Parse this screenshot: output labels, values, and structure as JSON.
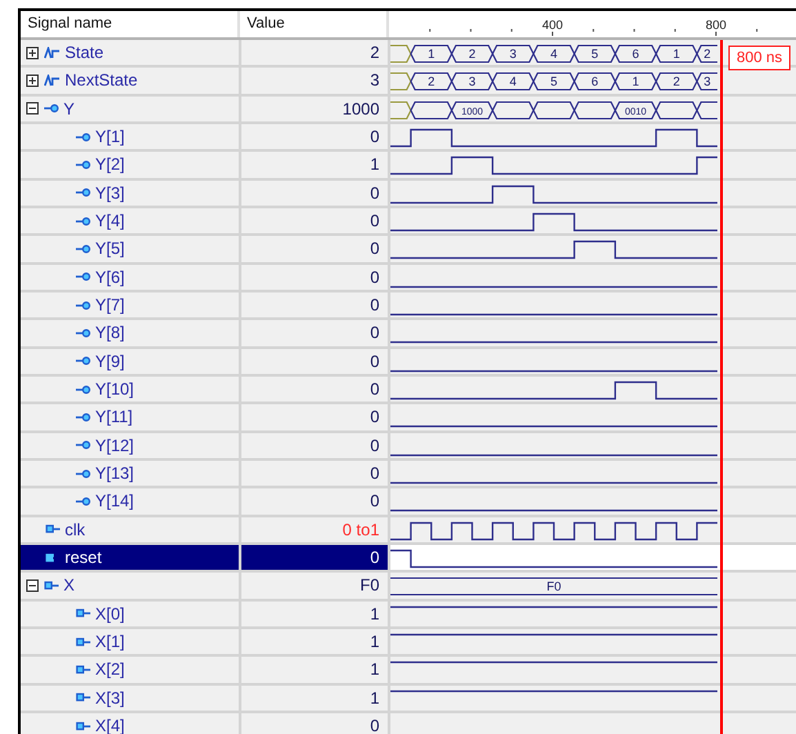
{
  "header": {
    "name": "Signal name",
    "value": "Value"
  },
  "ruler": {
    "ticks": [
      {
        "kind": "dot"
      },
      {
        "kind": "dot"
      },
      {
        "kind": "dot"
      },
      {
        "kind": "label",
        "label": "400"
      },
      {
        "kind": "dot"
      },
      {
        "kind": "dot"
      },
      {
        "kind": "dot"
      },
      {
        "kind": "label",
        "label": "800"
      },
      {
        "kind": "dot"
      }
    ]
  },
  "cursor": {
    "label": "800 ns"
  },
  "signals": [
    {
      "name": "State",
      "kind": "bus",
      "expanded": false,
      "selected": false,
      "changing": false,
      "value": "2",
      "wave": {
        "kind": "bus",
        "segments": [
          {
            "kind": "start"
          },
          {
            "kind": "full",
            "label": "1"
          },
          {
            "kind": "full",
            "label": "2"
          },
          {
            "kind": "full",
            "label": "3"
          },
          {
            "kind": "full",
            "label": "4"
          },
          {
            "kind": "full",
            "label": "5"
          },
          {
            "kind": "full",
            "label": "6"
          },
          {
            "kind": "full",
            "label": "1"
          },
          {
            "kind": "end",
            "label": "2"
          }
        ]
      }
    },
    {
      "name": "NextState",
      "kind": "bus",
      "expanded": false,
      "selected": false,
      "changing": false,
      "value": "3",
      "wave": {
        "kind": "bus",
        "segments": [
          {
            "kind": "start"
          },
          {
            "kind": "full",
            "label": "2"
          },
          {
            "kind": "full",
            "label": "3"
          },
          {
            "kind": "full",
            "label": "4"
          },
          {
            "kind": "full",
            "label": "5"
          },
          {
            "kind": "full",
            "label": "6"
          },
          {
            "kind": "full",
            "label": "1"
          },
          {
            "kind": "full",
            "label": "2"
          },
          {
            "kind": "end",
            "label": "3"
          }
        ]
      }
    },
    {
      "name": "Y",
      "kind": "out",
      "expanded": true,
      "selected": false,
      "changing": false,
      "value": "1000",
      "wave": {
        "kind": "bus",
        "segments": [
          {
            "kind": "start"
          },
          {
            "kind": "full"
          },
          {
            "kind": "full",
            "label": "1000"
          },
          {
            "kind": "full"
          },
          {
            "kind": "full"
          },
          {
            "kind": "full"
          },
          {
            "kind": "full",
            "label": "0010"
          },
          {
            "kind": "full"
          },
          {
            "kind": "end"
          }
        ]
      },
      "children": [
        {
          "name": "Y[1]",
          "kind": "out",
          "selected": false,
          "changing": false,
          "value": "0"
        },
        {
          "name": "Y[2]",
          "kind": "out",
          "selected": false,
          "changing": false,
          "value": "1"
        },
        {
          "name": "Y[3]",
          "kind": "out",
          "selected": false,
          "changing": false,
          "value": "0"
        },
        {
          "name": "Y[4]",
          "kind": "out",
          "selected": false,
          "changing": false,
          "value": "0"
        },
        {
          "name": "Y[5]",
          "kind": "out",
          "selected": false,
          "changing": false,
          "value": "0"
        },
        {
          "name": "Y[6]",
          "kind": "out",
          "selected": false,
          "changing": false,
          "value": "0"
        },
        {
          "name": "Y[7]",
          "kind": "out",
          "selected": false,
          "changing": false,
          "value": "0"
        },
        {
          "name": "Y[8]",
          "kind": "out",
          "selected": false,
          "changing": false,
          "value": "0"
        },
        {
          "name": "Y[9]",
          "kind": "out",
          "selected": false,
          "changing": false,
          "value": "0"
        },
        {
          "name": "Y[10]",
          "kind": "out",
          "selected": false,
          "changing": false,
          "value": "0"
        },
        {
          "name": "Y[11]",
          "kind": "out",
          "selected": false,
          "changing": false,
          "value": "0"
        },
        {
          "name": "Y[12]",
          "kind": "out",
          "selected": false,
          "changing": false,
          "value": "0"
        },
        {
          "name": "Y[13]",
          "kind": "out",
          "selected": false,
          "changing": false,
          "value": "0"
        },
        {
          "name": "Y[14]",
          "kind": "out",
          "selected": false,
          "changing": false,
          "value": "0"
        }
      ]
    },
    {
      "name": "clk",
      "kind": "in",
      "selected": false,
      "changing": true,
      "value": "0 to1"
    },
    {
      "name": "reset",
      "kind": "in",
      "selected": true,
      "changing": false,
      "value": "0"
    },
    {
      "name": "X",
      "kind": "in",
      "expanded": true,
      "selected": false,
      "changing": false,
      "value": "F0",
      "wave": {
        "kind": "bus",
        "segments": [
          {
            "kind": "whole",
            "label": "F0"
          }
        ]
      },
      "children": [
        {
          "name": "X[0]",
          "kind": "in",
          "selected": false,
          "changing": false,
          "value": "1"
        },
        {
          "name": "X[1]",
          "kind": "in",
          "selected": false,
          "changing": false,
          "value": "1"
        },
        {
          "name": "X[2]",
          "kind": "in",
          "selected": false,
          "changing": false,
          "value": "1"
        },
        {
          "name": "X[3]",
          "kind": "in",
          "selected": false,
          "changing": false,
          "value": "1"
        },
        {
          "name": "X[4]",
          "kind": "in",
          "selected": false,
          "changing": false,
          "value": "0"
        }
      ]
    }
  ]
}
